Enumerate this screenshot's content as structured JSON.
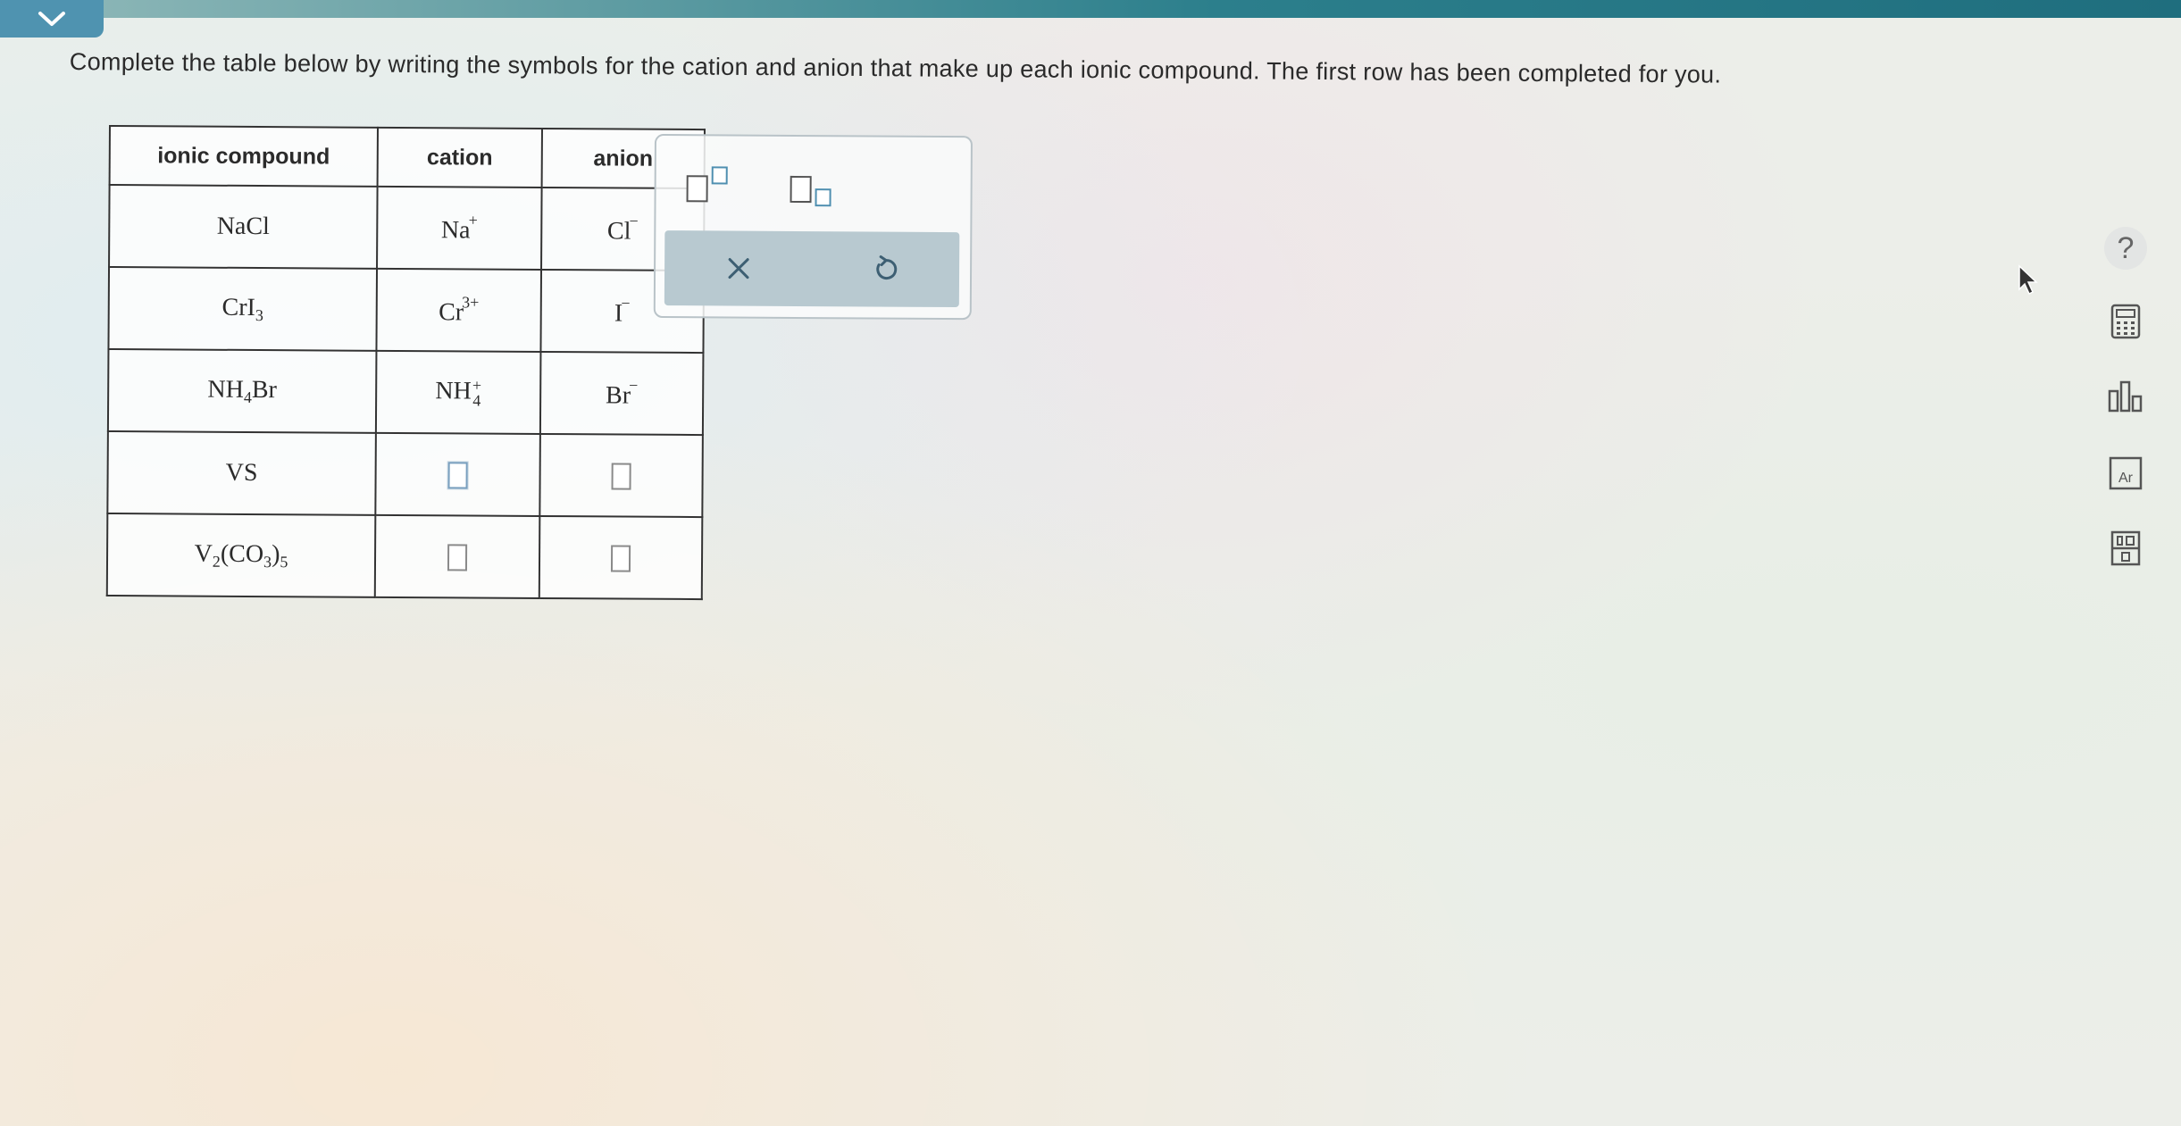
{
  "instructions": "Complete the table below by writing the symbols for the cation and anion that make up each ionic compound. The first row has been completed for you.",
  "table": {
    "headers": [
      "ionic compound",
      "cation",
      "anion"
    ],
    "rows": [
      {
        "compound": {
          "parts": [
            "NaCl"
          ]
        },
        "cation": {
          "base": "Na",
          "charge": "+"
        },
        "anion": {
          "base": "Cl",
          "charge": "−"
        }
      },
      {
        "compound": {
          "parts": [
            "CrI",
            "3"
          ]
        },
        "cation": {
          "base": "Cr",
          "charge": "3+"
        },
        "anion": {
          "base": "I",
          "charge": "−"
        }
      },
      {
        "compound": {
          "parts": [
            "NH",
            "4",
            "Br"
          ]
        },
        "cation": {
          "base": "NH",
          "sub": "4",
          "charge": "+"
        },
        "anion": {
          "base": "Br",
          "charge": "−"
        }
      },
      {
        "compound": {
          "parts": [
            "VS"
          ]
        },
        "cation": null,
        "anion": null
      },
      {
        "compound": {
          "parts": [
            "V",
            "2",
            "(CO",
            "3",
            ")",
            "5"
          ]
        },
        "cation": null,
        "anion": null
      }
    ]
  },
  "palette": {
    "buttons": [
      "superscript-template",
      "subscript-template",
      "clear",
      "undo"
    ]
  },
  "icons": {
    "collapse": "chevron-down-icon",
    "help": "question-icon",
    "calculator": "calculator-icon",
    "chart": "bar-chart-icon",
    "periodic_table": "periodic-table-icon",
    "reference": "reference-icon"
  },
  "help_label": "?",
  "periodic_tile_label": "Ar",
  "colors": {
    "accent": "#4f93b0",
    "topbar": "#2c7f8c",
    "palette_bar": "#b8c9d0"
  }
}
